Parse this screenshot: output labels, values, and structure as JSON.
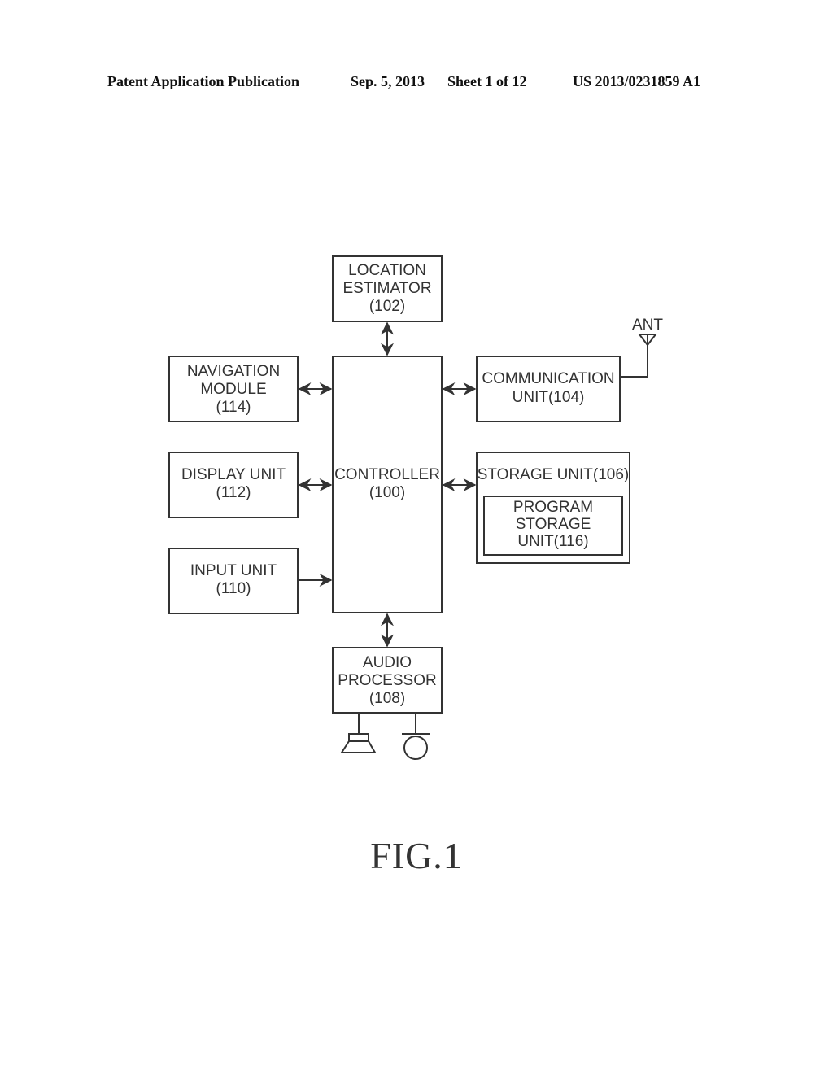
{
  "header": {
    "publication_type": "Patent Application Publication",
    "date": "Sep. 5, 2013",
    "sheet": "Sheet 1 of 12",
    "pub_number": "US 2013/0231859 A1"
  },
  "blocks": {
    "location_estimator": [
      "LOCATION",
      "ESTIMATOR",
      "(102)"
    ],
    "navigation_module": [
      "NAVIGATION",
      "MODULE",
      "(114)"
    ],
    "controller": [
      "CONTROLLER",
      "(100)"
    ],
    "communication_unit": [
      "COMMUNICATION",
      "UNIT(104)"
    ],
    "display_unit": [
      "DISPLAY UNIT",
      "(112)"
    ],
    "storage_unit": [
      "STORAGE UNIT(106)"
    ],
    "program_storage_unit": [
      "PROGRAM",
      "STORAGE",
      "UNIT(116)"
    ],
    "input_unit": [
      "INPUT UNIT",
      "(110)"
    ],
    "audio_processor": [
      "AUDIO",
      "PROCESSOR",
      "(108)"
    ]
  },
  "antenna_label": "ANT",
  "connections": [
    {
      "from": "location_estimator",
      "to": "controller",
      "direction": "bidirectional"
    },
    {
      "from": "navigation_module",
      "to": "controller",
      "direction": "bidirectional"
    },
    {
      "from": "display_unit",
      "to": "controller",
      "direction": "bidirectional"
    },
    {
      "from": "input_unit",
      "to": "controller",
      "direction": "one-way"
    },
    {
      "from": "communication_unit",
      "to": "controller",
      "direction": "bidirectional"
    },
    {
      "from": "storage_unit",
      "to": "controller",
      "direction": "bidirectional"
    },
    {
      "from": "audio_processor",
      "to": "controller",
      "direction": "bidirectional"
    }
  ],
  "figure_label": "FIG.1"
}
